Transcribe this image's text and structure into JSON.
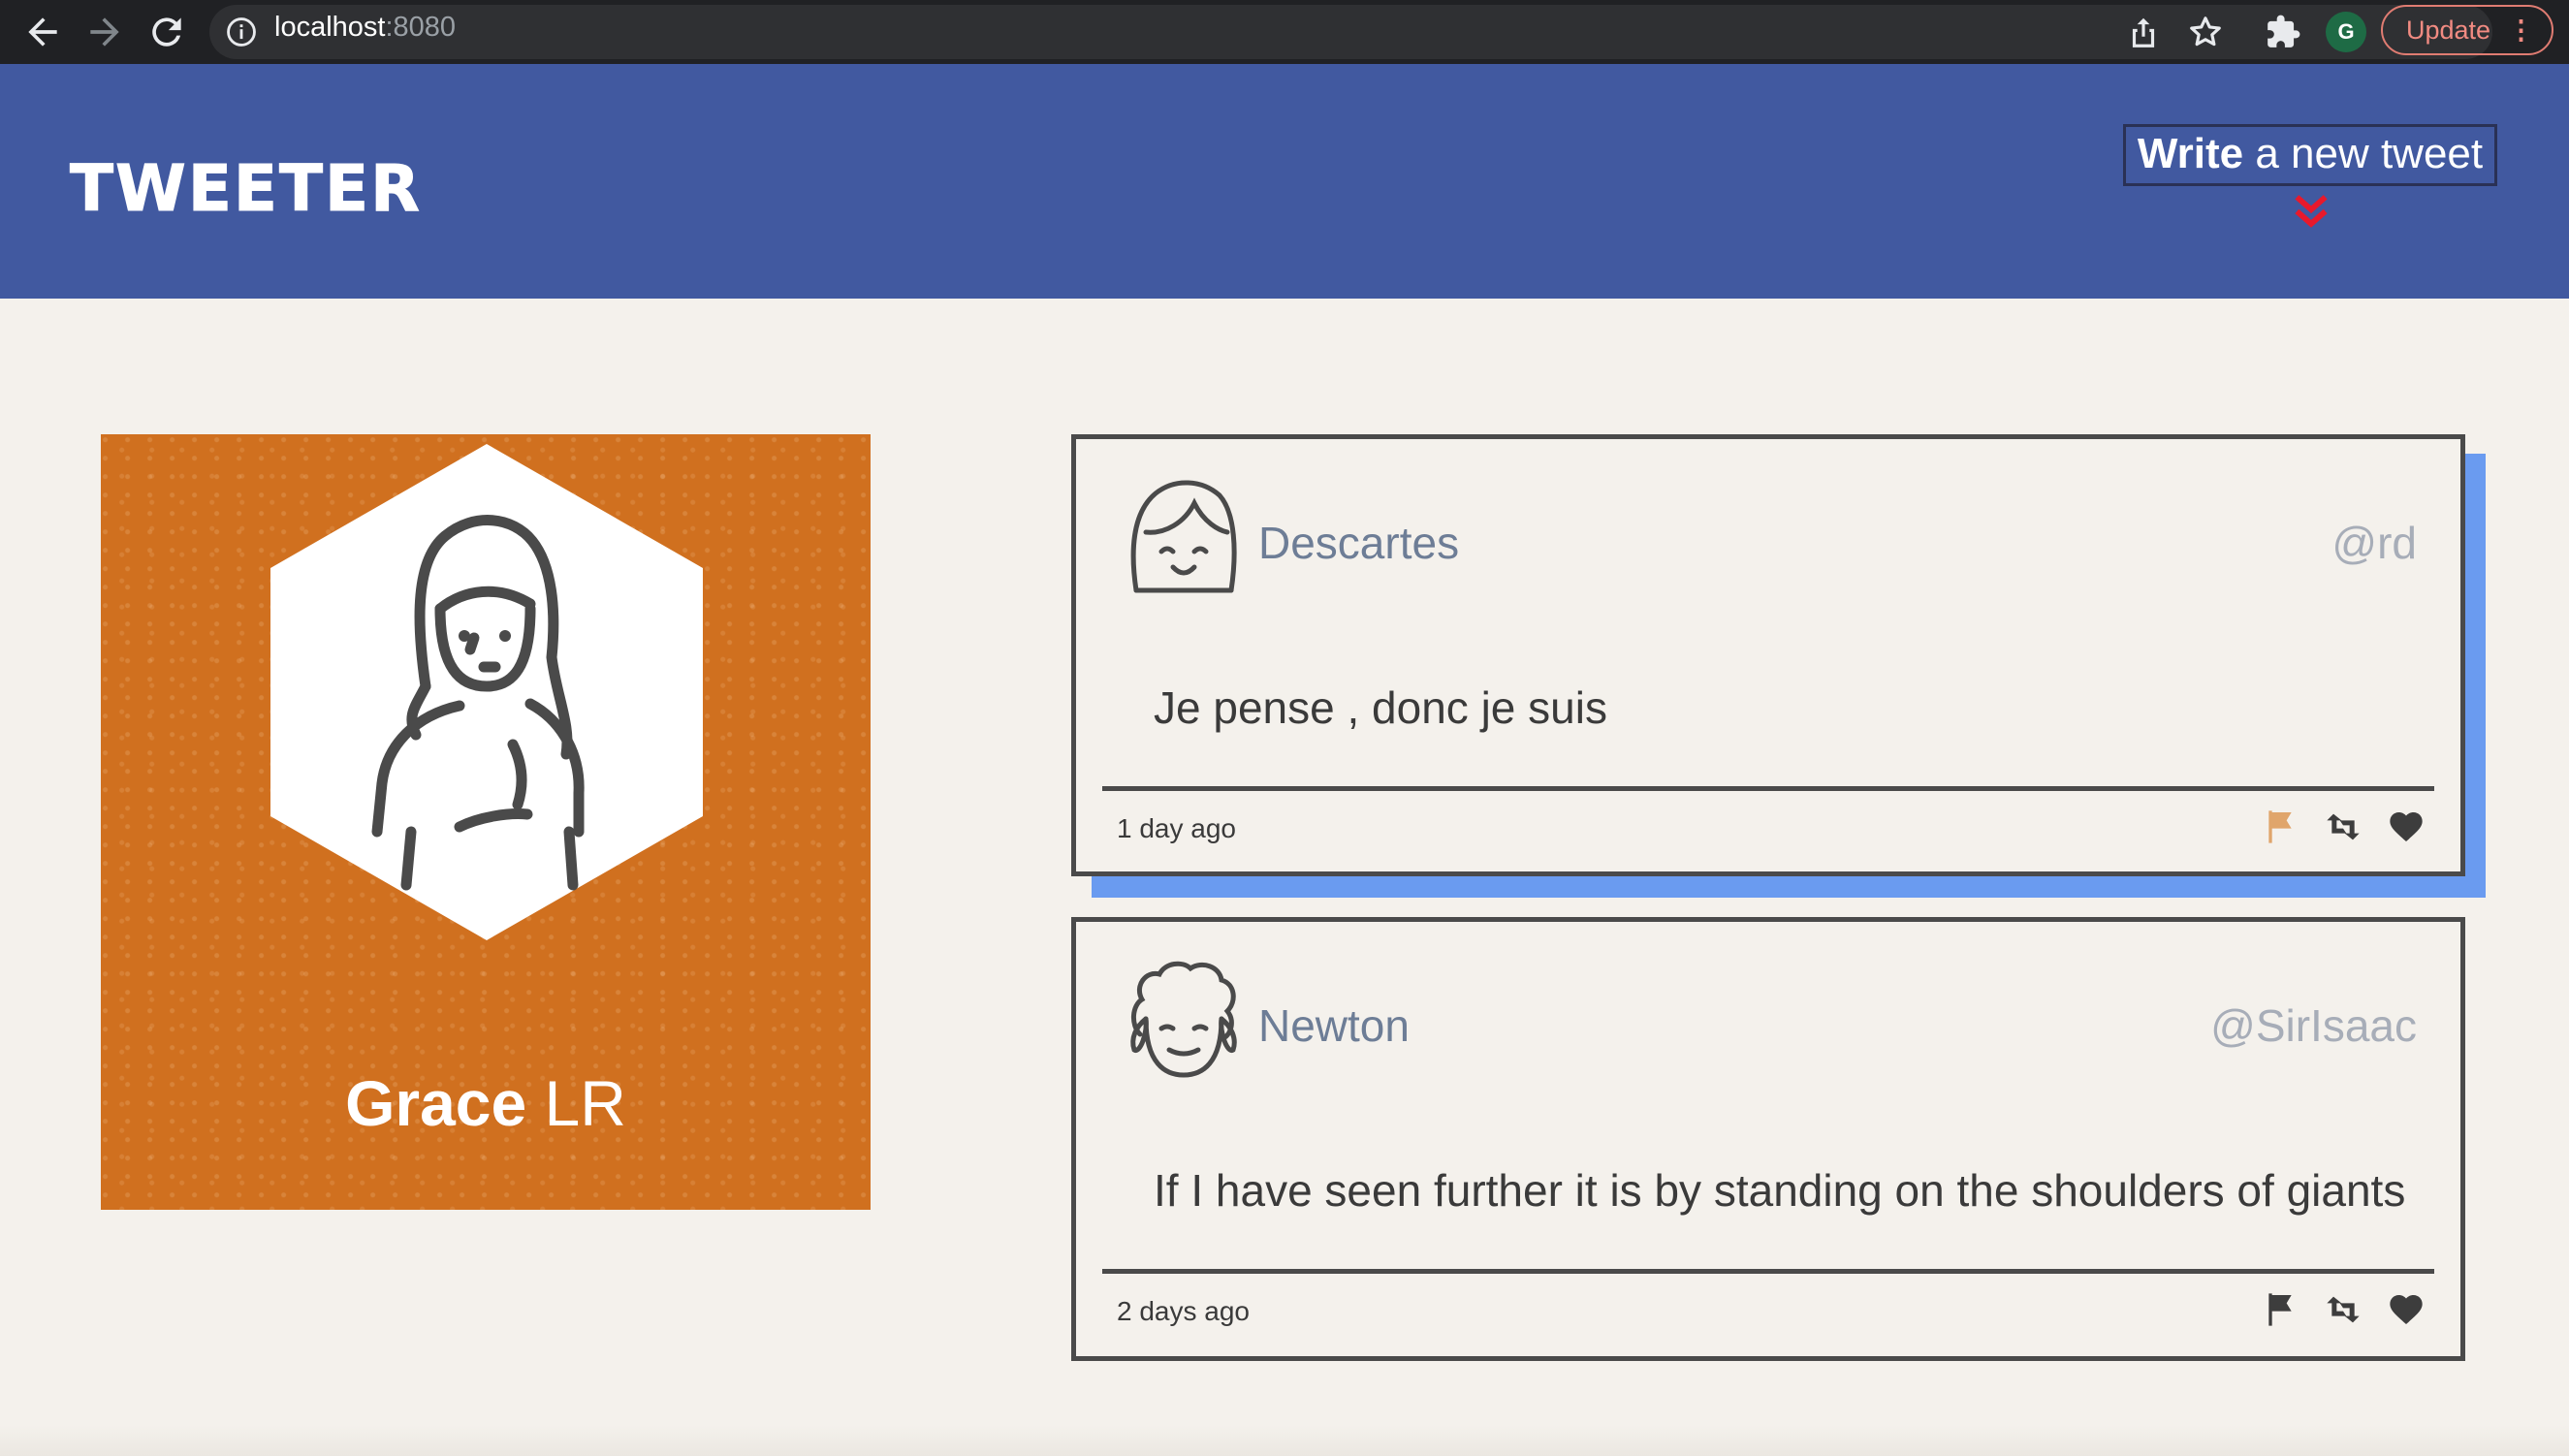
{
  "browser": {
    "url_host": "localhost",
    "url_port": ":8080",
    "profile_initial": "G",
    "update_label": "Update",
    "menu_glyph": "⋮",
    "icons": [
      "back-icon",
      "forward-icon",
      "reload-icon",
      "info-icon",
      "share-icon",
      "star-icon",
      "extensions-icon"
    ]
  },
  "header": {
    "logo": "TWEETER",
    "compose_bold": "Write",
    "compose_rest": " a new tweet",
    "chevron_color": "#e8192c",
    "background": "#4159a0"
  },
  "profile": {
    "first_name": "Grace",
    "last_name": " LR",
    "card_color": "#d0701f"
  },
  "tweets": [
    {
      "name": "Descartes",
      "handle": "@rd",
      "text": "Je pense , donc je suis",
      "time": "1 day ago",
      "flag_color": "#e0a56b",
      "actions": [
        "flag-icon",
        "retweet-icon",
        "heart-icon"
      ]
    },
    {
      "name": "Newton",
      "handle": "@SirIsaac",
      "text": "If I have seen further it is by standing on the shoulders of giants",
      "time": "2 days ago",
      "flag_color": "#3d3d3d",
      "actions": [
        "flag-icon",
        "retweet-icon",
        "heart-icon"
      ]
    }
  ],
  "colors": {
    "page_bg": "#f4f1ec",
    "hover_shadow": "#6a9bf0",
    "border": "#4a4a4a"
  }
}
